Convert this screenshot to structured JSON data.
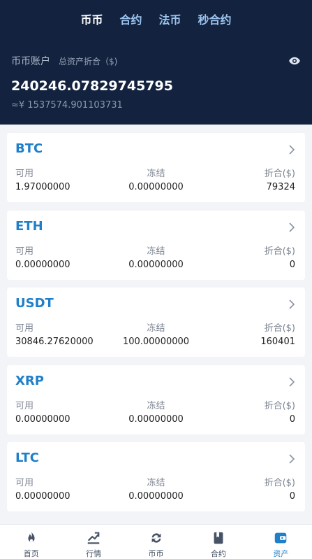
{
  "header": {
    "tabs": [
      {
        "label": "币币",
        "active": true
      },
      {
        "label": "合约",
        "active": false
      },
      {
        "label": "法币",
        "active": false
      },
      {
        "label": "秒合约",
        "active": false
      }
    ],
    "account_title": "币币账户",
    "total_label": "总资产折合（$)",
    "total_usd": "240246.07829745795",
    "total_cny": "≈¥ 1537574.901103731",
    "eye_icon": "eye-icon"
  },
  "assets": [
    {
      "coin": "BTC",
      "available_label": "可用",
      "frozen_label": "冻结",
      "value_label": "折合($)",
      "available": "1.97000000",
      "frozen": "0.00000000",
      "value": "79324"
    },
    {
      "coin": "ETH",
      "available_label": "可用",
      "frozen_label": "冻结",
      "value_label": "折合($)",
      "available": "0.00000000",
      "frozen": "0.00000000",
      "value": "0"
    },
    {
      "coin": "USDT",
      "available_label": "可用",
      "frozen_label": "冻结",
      "value_label": "折合($)",
      "available": "30846.27620000",
      "frozen": "100.00000000",
      "value": "160401"
    },
    {
      "coin": "XRP",
      "available_label": "可用",
      "frozen_label": "冻结",
      "value_label": "折合($)",
      "available": "0.00000000",
      "frozen": "0.00000000",
      "value": "0"
    },
    {
      "coin": "LTC",
      "available_label": "可用",
      "frozen_label": "冻结",
      "value_label": "折合($)",
      "available": "0.00000000",
      "frozen": "0.00000000",
      "value": "0"
    }
  ],
  "bottom_nav": [
    {
      "label": "首页",
      "icon": "flame-icon",
      "active": false
    },
    {
      "label": "行情",
      "icon": "chart-icon",
      "active": false
    },
    {
      "label": "币币",
      "icon": "exchange-icon",
      "active": false
    },
    {
      "label": "合约",
      "icon": "contract-icon",
      "active": false
    },
    {
      "label": "资产",
      "icon": "wallet-icon",
      "active": true
    }
  ],
  "colors": {
    "header_bg": "#13233f",
    "accent": "#1f7fc9",
    "tab_inactive": "#9cc4ee"
  }
}
